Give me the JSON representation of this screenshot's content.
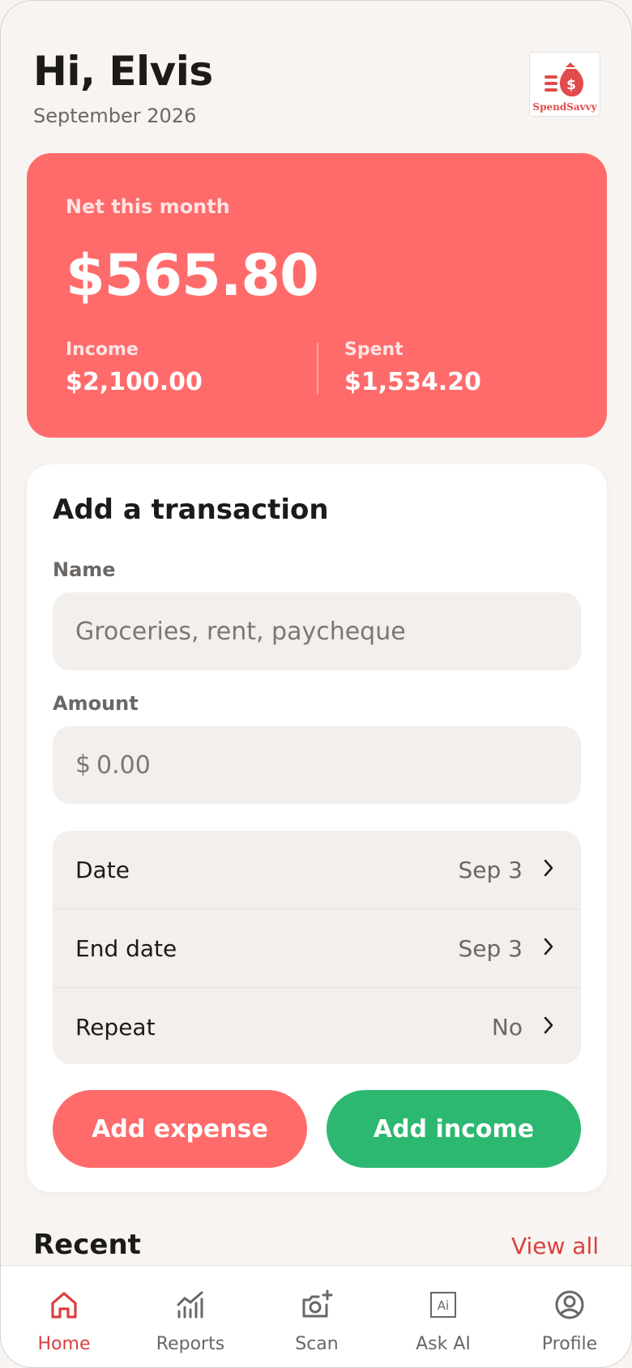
{
  "header": {
    "greeting": "Hi, Elvis",
    "month": "September 2026",
    "logo_text": "SpendSavvy"
  },
  "summary": {
    "net_label": "Net this month",
    "net_amount": "$565.80",
    "income_label": "Income",
    "income_amount": "$2,100.00",
    "spent_label": "Spent",
    "spent_amount": "$1,534.20"
  },
  "form": {
    "title": "Add a transaction",
    "name_label": "Name",
    "name_placeholder": "Groceries, rent, paycheque",
    "amount_label": "Amount",
    "currency_symbol": "$",
    "amount_placeholder": "0.00",
    "rows": [
      {
        "label": "Date",
        "value": "Sep 3"
      },
      {
        "label": "End date",
        "value": "Sep 3"
      },
      {
        "label": "Repeat",
        "value": "No"
      }
    ],
    "add_expense_label": "Add expense",
    "add_income_label": "Add income"
  },
  "recent": {
    "title": "Recent",
    "view_all_label": "View all"
  },
  "tabs": [
    {
      "label": "Home",
      "icon": "home-icon",
      "active": true
    },
    {
      "label": "Reports",
      "icon": "reports-icon",
      "active": false
    },
    {
      "label": "Scan",
      "icon": "camera-plus-icon",
      "active": false
    },
    {
      "label": "Ask AI",
      "icon": "ai-icon",
      "active": false
    },
    {
      "label": "Profile",
      "icon": "profile-icon",
      "active": false
    }
  ],
  "colors": {
    "accent_red": "#ff6b6b",
    "income_green": "#2db872",
    "link_red": "#d9403f",
    "background": "#f7f4f1"
  }
}
